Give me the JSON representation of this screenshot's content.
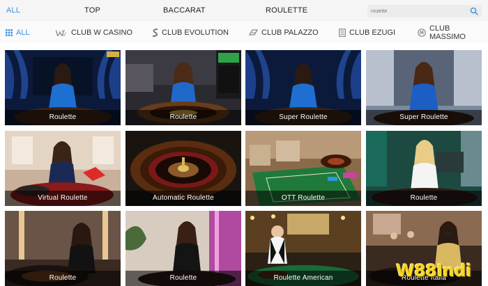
{
  "top_nav": {
    "tabs": [
      {
        "label": "ALL",
        "active": true
      },
      {
        "label": "TOP",
        "active": false
      },
      {
        "label": "BACCARAT",
        "active": false
      },
      {
        "label": "ROULETTE",
        "active": false
      }
    ],
    "search": {
      "value": "roulette",
      "icon": "search-icon"
    }
  },
  "sub_nav": {
    "items": [
      {
        "label": "ALL",
        "icon": "grid-icon",
        "active": true
      },
      {
        "label": "CLUB W CASINO",
        "icon": "w-logo-icon",
        "active": false
      },
      {
        "label": "CLUB EVOLUTION",
        "icon": "evolution-logo-icon",
        "active": false
      },
      {
        "label": "CLUB PALAZZO",
        "icon": "palazzo-logo-icon",
        "active": false
      },
      {
        "label": "CLUB EZUGI",
        "icon": "ezugi-logo-icon",
        "active": false
      },
      {
        "label": "CLUB MASSIMO",
        "icon": "massimo-logo-icon",
        "active": false
      }
    ]
  },
  "games": [
    {
      "title": "Roulette",
      "theme": "blue-curtain"
    },
    {
      "title": "Roulette",
      "theme": "studio-wheel"
    },
    {
      "title": "Super Roulette",
      "theme": "blue-curtain"
    },
    {
      "title": "Super Roulette",
      "theme": "blue-stage"
    },
    {
      "title": "Virtual Roulette",
      "theme": "virtual-studio"
    },
    {
      "title": "Automatic Roulette",
      "theme": "auto-wheel"
    },
    {
      "title": "OTT Roulette",
      "theme": "green-table"
    },
    {
      "title": "Roulette",
      "theme": "green-lounge"
    },
    {
      "title": "Roulette",
      "theme": "dark-stage"
    },
    {
      "title": "Roulette",
      "theme": "pink-studio"
    },
    {
      "title": "Roulette American",
      "theme": "casino-floor"
    },
    {
      "title": "Roulette Italia",
      "theme": "gold-lounge"
    }
  ],
  "watermark": {
    "text": "W88Indi"
  },
  "colors": {
    "accent": "#3a8ee6",
    "watermark": "#f5d623"
  }
}
